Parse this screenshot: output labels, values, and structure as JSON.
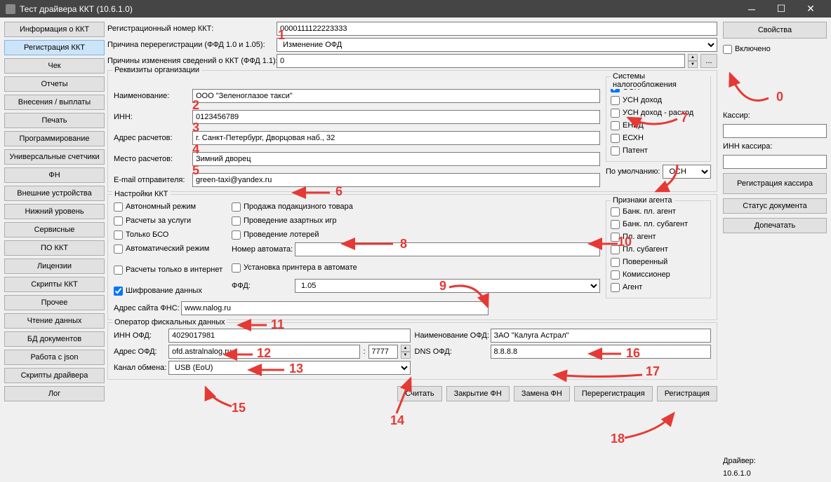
{
  "titlebar": {
    "title": "Тест драйвера ККТ (10.6.1.0)"
  },
  "sidebar": [
    "Информация о ККТ",
    "Регистрация ККТ",
    "Чек",
    "Отчеты",
    "Внесения / выплаты",
    "Печать",
    "Программирование",
    "Универсальные счетчики",
    "ФН",
    "Внешние устройства",
    "Нижний уровень",
    "Сервисные",
    "ПО ККТ",
    "Лицензии",
    "Скрипты ККТ",
    "Прочее",
    "Чтение данных",
    "БД документов",
    "Работа с json",
    "Скрипты драйвера",
    "Лог"
  ],
  "top": {
    "reg_num_lbl": "Регистрационный номер ККТ:",
    "reg_num": "0000111122223333",
    "rereg_reason_lbl": "Причина перерегистрации (ФФД 1.0 и 1.05):",
    "rereg_reason": "Изменение ОФД",
    "change_reason_lbl": "Причины изменения сведений о ККТ (ФФД 1.1):",
    "change_reason": "0"
  },
  "org": {
    "legend": "Реквизиты организации",
    "name_lbl": "Наименование:",
    "name": "ООО \"Зеленоглазое такси\"",
    "inn_lbl": "ИНН:",
    "inn": "0123456789",
    "addr_lbl": "Адрес расчетов:",
    "addr": "г. Санкт-Петербург, Дворцовая наб., 32",
    "place_lbl": "Место расчетов:",
    "place": "Зимний дворец",
    "email_lbl": "E-mail отправителя:",
    "email": "green-taxi@yandex.ru",
    "tax_legend": "Системы налогообложения",
    "tax": [
      "ОСН",
      "УСН доход",
      "УСН доход - расход",
      "ЕНВД",
      "ЕСХН",
      "Патент"
    ],
    "default_lbl": "По умолчанию:",
    "default": "ОСН"
  },
  "kkt": {
    "legend": "Настройки ККТ",
    "cb_col1": [
      "Автономный режим",
      "Расчеты за услуги",
      "Только БСО",
      "Автоматический режим",
      "Расчеты только в интернет",
      "Шифрование данных"
    ],
    "cb_col2": [
      "Продажа подакцизного товара",
      "Проведение азартных игр",
      "Проведение лотерей"
    ],
    "auto_num_lbl": "Номер автомата:",
    "printer_lbl": "Установка принтера в автомате",
    "ffd_lbl": "ФФД:",
    "ffd": "1.05",
    "fns_lbl": "Адрес сайта ФНС:",
    "fns": "www.nalog.ru",
    "agent_legend": "Признаки агента",
    "agents": [
      "Банк. пл. агент",
      "Банк. пл. субагент",
      "Пл. агент",
      "Пл. субагент",
      "Поверенный",
      "Комиссионер",
      "Агент"
    ]
  },
  "ofd": {
    "legend": "Оператор фискальных данных",
    "inn_lbl": "ИНН ОФД:",
    "inn": "4029017981",
    "name_lbl": "Наименование ОФД:",
    "name": "ЗАО \"Калуга Астрал\"",
    "addr_lbl": "Адрес ОФД:",
    "addr": "ofd.astralnalog.ru",
    "port": "7777",
    "dns_lbl": "DNS ОФД:",
    "dns": "8.8.8.8",
    "chan_lbl": "Канал обмена:",
    "chan": "USB (EoU)"
  },
  "actions": [
    "Считать",
    "Закрытие ФН",
    "Замена ФН",
    "Перерегистрация",
    "Регистрация"
  ],
  "right": {
    "props": "Свойства",
    "enabled": "Включено",
    "cashier_lbl": "Кассир:",
    "cashier_inn_lbl": "ИНН кассира:",
    "reg_cashier": "Регистрация кассира",
    "doc_status": "Статус документа",
    "reprint": "Допечатать",
    "driver_lbl": "Драйвер:",
    "driver_ver": "10.6.1.0"
  },
  "annots": {
    "n0": "0",
    "n1": "1",
    "n2": "2",
    "n3": "3",
    "n4": "4",
    "n5": "5",
    "n6": "6",
    "n7": "7",
    "n8": "8",
    "n9": "9",
    "n10": "10",
    "n11": "11",
    "n12": "12",
    "n13": "13",
    "n14": "14",
    "n15": "15",
    "n16": "16",
    "n17": "17",
    "n18": "18"
  }
}
